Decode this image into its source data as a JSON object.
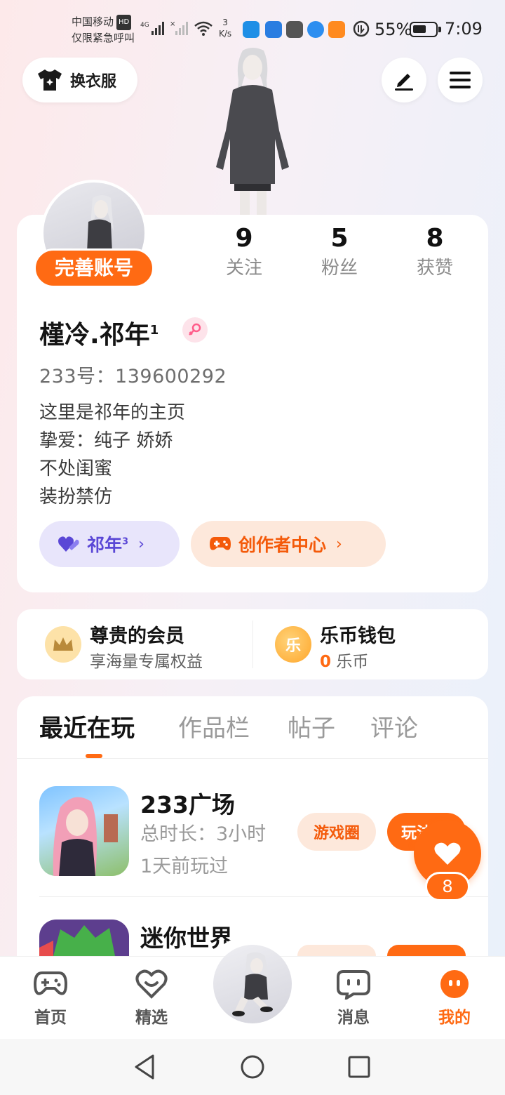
{
  "status_bar": {
    "carrier_line1": "中国移动",
    "hd": "HD",
    "carrier_line2": "仅限紧急呼叫",
    "network": "4G",
    "speed_value": "3",
    "speed_unit": "K/s",
    "battery_pct": "55%",
    "battery_level": 0.55,
    "time": "7:09"
  },
  "header": {
    "dress_label": "换衣服"
  },
  "profile": {
    "complete_badge": "完善账号",
    "stats": [
      {
        "num": "9",
        "label": "关注"
      },
      {
        "num": "5",
        "label": "粉丝"
      },
      {
        "num": "8",
        "label": "获赞"
      }
    ],
    "name": "槿冷.祁年",
    "name_sup": "1",
    "uid": "233号：139600292",
    "bio": [
      "这里是祁年的主页",
      "挚爱：纯子  娇娇",
      "不处闺蜜",
      "装扮禁仿"
    ],
    "chip_group": "祁年",
    "chip_group_sup": "3",
    "chip_creator": "创作者中心"
  },
  "assets": {
    "member_title": "尊贵的会员",
    "member_sub": "享海量专属权益",
    "wallet_title": "乐币钱包",
    "wallet_amount": "0",
    "wallet_unit": "乐币",
    "coin_char": "乐"
  },
  "tabs": [
    "最近在玩",
    "作品栏",
    "帖子",
    "评论"
  ],
  "games": [
    {
      "name": "233广场",
      "duration": "总时长：3小时",
      "last_played": "1天前玩过",
      "circle_label": "游戏圈",
      "play_label": "玩法"
    },
    {
      "name": "迷你世界",
      "duration": "",
      "last_played": "",
      "circle_label": "",
      "play_label": ""
    }
  ],
  "floating_like": {
    "count": "8"
  },
  "bottom_nav": [
    {
      "label": "首页"
    },
    {
      "label": "精选"
    },
    {
      "label": "消息"
    },
    {
      "label": "我的"
    }
  ],
  "colors": {
    "accent": "#ff6a13",
    "purple": "#5a47d6"
  }
}
